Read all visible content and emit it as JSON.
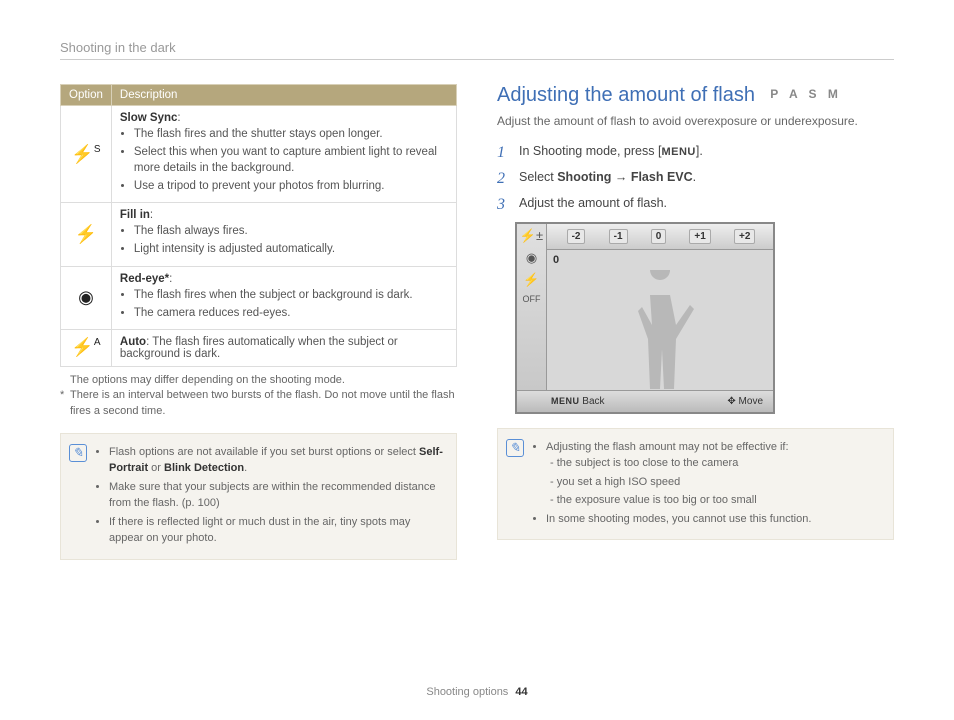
{
  "header": {
    "title": "Shooting in the dark"
  },
  "table": {
    "head": {
      "option": "Option",
      "desc": "Description"
    },
    "rows": [
      {
        "icon": "flash-s-icon",
        "glyph": "⚡",
        "sup": "S",
        "title": "Slow Sync",
        "bullets": [
          "The flash fires and the shutter stays open longer.",
          "Select this when you want to capture ambient light to reveal more details in the background.",
          "Use a tripod to prevent your photos from blurring."
        ]
      },
      {
        "icon": "flash-fill-icon",
        "glyph": "⚡",
        "sup": "",
        "title": "Fill in",
        "bullets": [
          "The flash always fires.",
          "Light intensity is adjusted automatically."
        ]
      },
      {
        "icon": "redeye-icon",
        "glyph": "◉",
        "sup": "",
        "title": "Red-eye*",
        "bullets": [
          "The flash fires when the subject or background is dark.",
          "The camera reduces red-eyes."
        ]
      },
      {
        "icon": "flash-auto-icon",
        "glyph": "⚡",
        "sup": "A",
        "title": "Auto",
        "inline_desc": ": The flash fires automatically when the subject or background is dark."
      }
    ]
  },
  "table_notes": {
    "line1": "The options may differ depending on the shooting mode.",
    "line2": "There is an interval between two bursts of the flash. Do not move until the flash fires a second time."
  },
  "left_notebox": {
    "b1_pre": "Flash options are not available if you set burst options or select ",
    "b1_bold1": "Self-Portrait",
    "b1_mid": " or ",
    "b1_bold2": "Blink Detection",
    "b1_post": ".",
    "b2": "Make sure that your subjects are within the recommended distance from the flash. (p. 100)",
    "b3": "If there is reflected light or much dust in the air, tiny spots may appear on your photo."
  },
  "right": {
    "title": "Adjusting the amount of flash",
    "modes": "P A S M",
    "intro": "Adjust the amount of flash to avoid overexposure or underexposure.",
    "steps": {
      "s1_pre": "In Shooting mode, press [",
      "s1_menu": "MENU",
      "s1_post": "].",
      "s2_pre": "Select ",
      "s2_b1": "Shooting",
      "s2_arrow": " → ",
      "s2_b2": "Flash EVC",
      "s2_post": ".",
      "s3": "Adjust the amount of flash."
    },
    "cam": {
      "scale": [
        "-2",
        "-1",
        "0",
        "+1",
        "+2"
      ],
      "value": "0",
      "back": "Back",
      "move": "Move",
      "menu": "MENU"
    },
    "notebox": {
      "b1": "Adjusting the flash amount may not be effective if:",
      "sub": [
        "the subject is too close to the camera",
        "you set a high ISO speed",
        "the exposure value is too big or too small"
      ],
      "b2": "In some shooting modes, you cannot use this function."
    }
  },
  "footer": {
    "section": "Shooting options",
    "page": "44"
  }
}
